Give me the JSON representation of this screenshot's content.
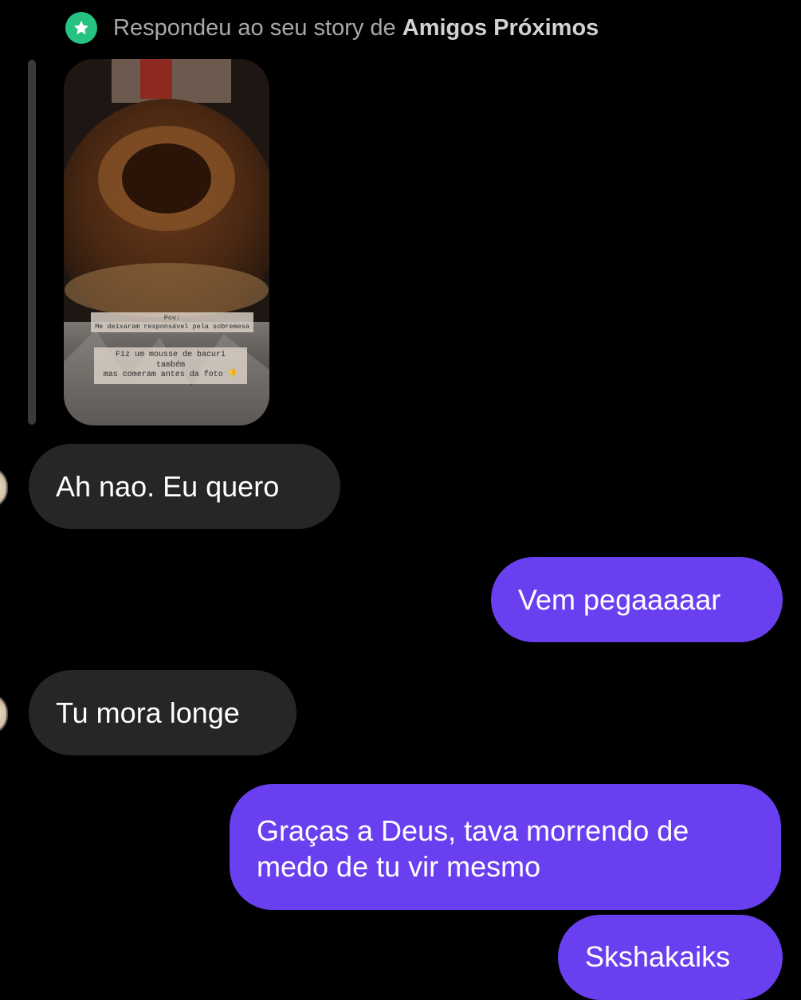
{
  "header": {
    "icon": "star-icon",
    "prefix": "Respondeu ao seu story de ",
    "strong": "Amigos Próximos",
    "icon_color": "#26c281"
  },
  "story": {
    "caption_line1": "Pov:",
    "caption_line2": "Me deixaram responsável pela sobremesa",
    "caption_line3": "Fiz um mousse de bacuri também",
    "caption_line4": "mas comeram antes da foto 👎"
  },
  "messages": [
    {
      "from": "them",
      "text": "Ah nao. Eu quero"
    },
    {
      "from": "me",
      "text": "Vem pegaaaaar"
    },
    {
      "from": "them",
      "text": "Tu mora longe"
    },
    {
      "from": "me",
      "text": "Graças a Deus, tava morrendo de medo de tu vir mesmo"
    },
    {
      "from": "me",
      "text": "Skshakaiks"
    }
  ],
  "colors": {
    "background": "#000000",
    "incoming_bubble": "#262626",
    "outgoing_bubble": "#6a3ff0"
  }
}
